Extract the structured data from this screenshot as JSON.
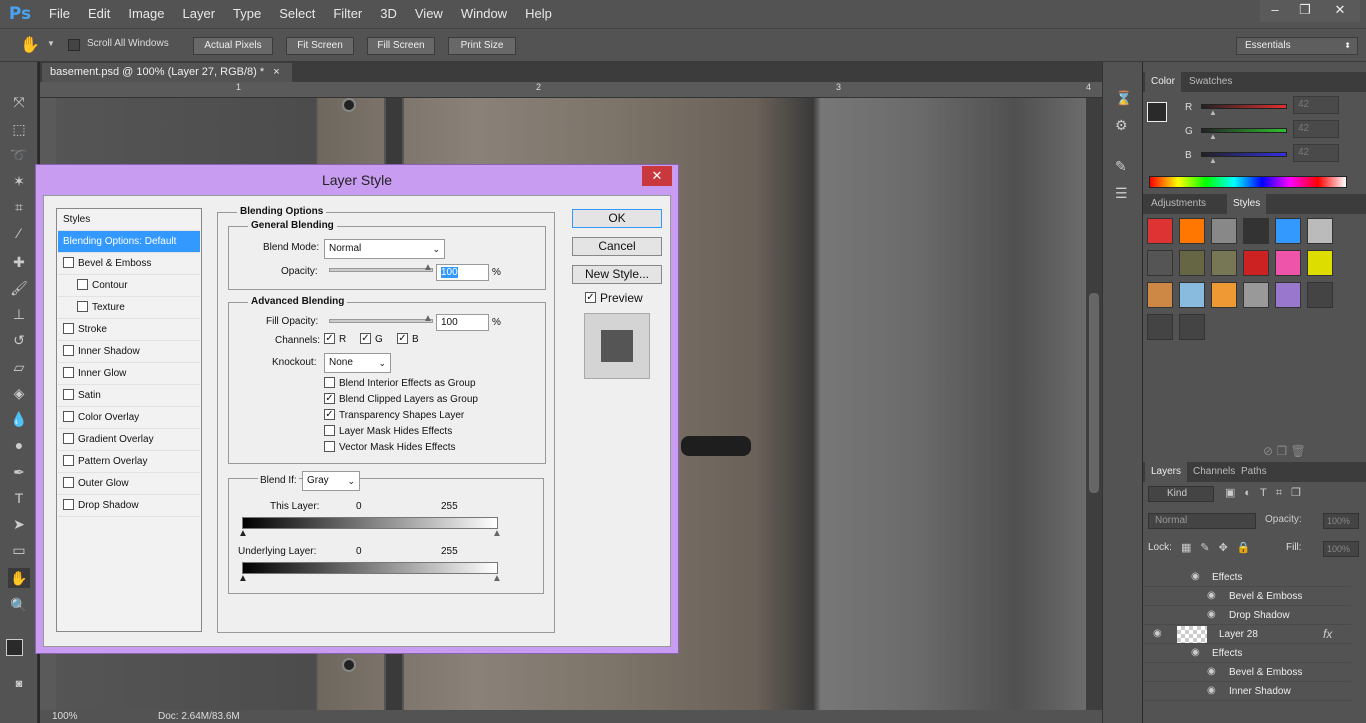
{
  "app": {
    "logo": "Ps",
    "menus": [
      "File",
      "Edit",
      "Image",
      "Layer",
      "Type",
      "Select",
      "Filter",
      "3D",
      "View",
      "Window",
      "Help"
    ]
  },
  "window_buttons": [
    "–",
    "❐",
    "✕"
  ],
  "options": {
    "scroll_all": "Scroll All Windows",
    "actual_pixels": "Actual Pixels",
    "fit_screen": "Fit Screen",
    "fill_screen": "Fill Screen",
    "print_size": "Print Size",
    "workspace": "Essentials"
  },
  "document": {
    "tab": "basement.psd @ 100% (Layer 27, RGB/8) *",
    "tab_close": "×",
    "ruler_marks": [
      "1",
      "2",
      "3",
      "4"
    ]
  },
  "status": {
    "zoom": "100%",
    "doc": "Doc: 2.64M/83.6M"
  },
  "color_panel": {
    "tabs": [
      "Color",
      "Swatches"
    ],
    "channels": [
      {
        "label": "R",
        "value": "42",
        "color": "#e03030"
      },
      {
        "label": "G",
        "value": "42",
        "color": "#30c030"
      },
      {
        "label": "B",
        "value": "42",
        "color": "#3030e0"
      }
    ]
  },
  "styles_panel": {
    "tabs": [
      "Adjustments",
      "Styles"
    ]
  },
  "layers_panel": {
    "tabs": [
      "Layers",
      "Channels",
      "Paths"
    ],
    "kind": "Kind",
    "blend": "Normal",
    "opacity_label": "Opacity:",
    "opacity": "100%",
    "lock_label": "Lock:",
    "fill_label": "Fill:",
    "fill": "100%",
    "rows": [
      {
        "text": "Effects",
        "indent": 1
      },
      {
        "text": "Bevel & Emboss",
        "indent": 2
      },
      {
        "text": "Drop Shadow",
        "indent": 2
      },
      {
        "text": "Layer 28",
        "indent": 0,
        "fx": "fx"
      },
      {
        "text": "Effects",
        "indent": 1
      },
      {
        "text": "Bevel & Emboss",
        "indent": 2
      },
      {
        "text": "Inner Shadow",
        "indent": 2
      }
    ]
  },
  "dialog": {
    "title": "Layer Style",
    "close": "✕",
    "styles_header": "Styles",
    "style_items": [
      {
        "label": "Blending Options: Default",
        "selected": true,
        "check": false,
        "indent": false
      },
      {
        "label": "Bevel & Emboss",
        "check": true,
        "indent": false
      },
      {
        "label": "Contour",
        "check": true,
        "indent": true
      },
      {
        "label": "Texture",
        "check": true,
        "indent": true
      },
      {
        "label": "Stroke",
        "check": true,
        "indent": false
      },
      {
        "label": "Inner Shadow",
        "check": true,
        "indent": false
      },
      {
        "label": "Inner Glow",
        "check": true,
        "indent": false
      },
      {
        "label": "Satin",
        "check": true,
        "indent": false
      },
      {
        "label": "Color Overlay",
        "check": true,
        "indent": false
      },
      {
        "label": "Gradient Overlay",
        "check": true,
        "indent": false
      },
      {
        "label": "Pattern Overlay",
        "check": true,
        "indent": false
      },
      {
        "label": "Outer Glow",
        "check": true,
        "indent": false
      },
      {
        "label": "Drop Shadow",
        "check": true,
        "indent": false
      }
    ],
    "blending_options_title": "Blending Options",
    "general_title": "General Blending",
    "blend_mode_label": "Blend Mode:",
    "blend_mode": "Normal",
    "opacity_label": "Opacity:",
    "opacity": "100",
    "percent": "%",
    "advanced_title": "Advanced Blending",
    "fill_opacity_label": "Fill Opacity:",
    "fill_opacity": "100",
    "channels_label": "Channels:",
    "channels": [
      "R",
      "G",
      "B"
    ],
    "knockout_label": "Knockout:",
    "knockout": "None",
    "options": [
      {
        "label": "Blend Interior Effects as Group",
        "checked": false
      },
      {
        "label": "Blend Clipped Layers as Group",
        "checked": true
      },
      {
        "label": "Transparency Shapes Layer",
        "checked": true
      },
      {
        "label": "Layer Mask Hides Effects",
        "checked": false
      },
      {
        "label": "Vector Mask Hides Effects",
        "checked": false
      }
    ],
    "blend_if_label": "Blend If:",
    "blend_if": "Gray",
    "this_layer_label": "This Layer:",
    "underlying_label": "Underlying Layer:",
    "range_min": "0",
    "range_max": "255",
    "ok": "OK",
    "cancel": "Cancel",
    "new_style": "New Style...",
    "preview": "Preview"
  }
}
